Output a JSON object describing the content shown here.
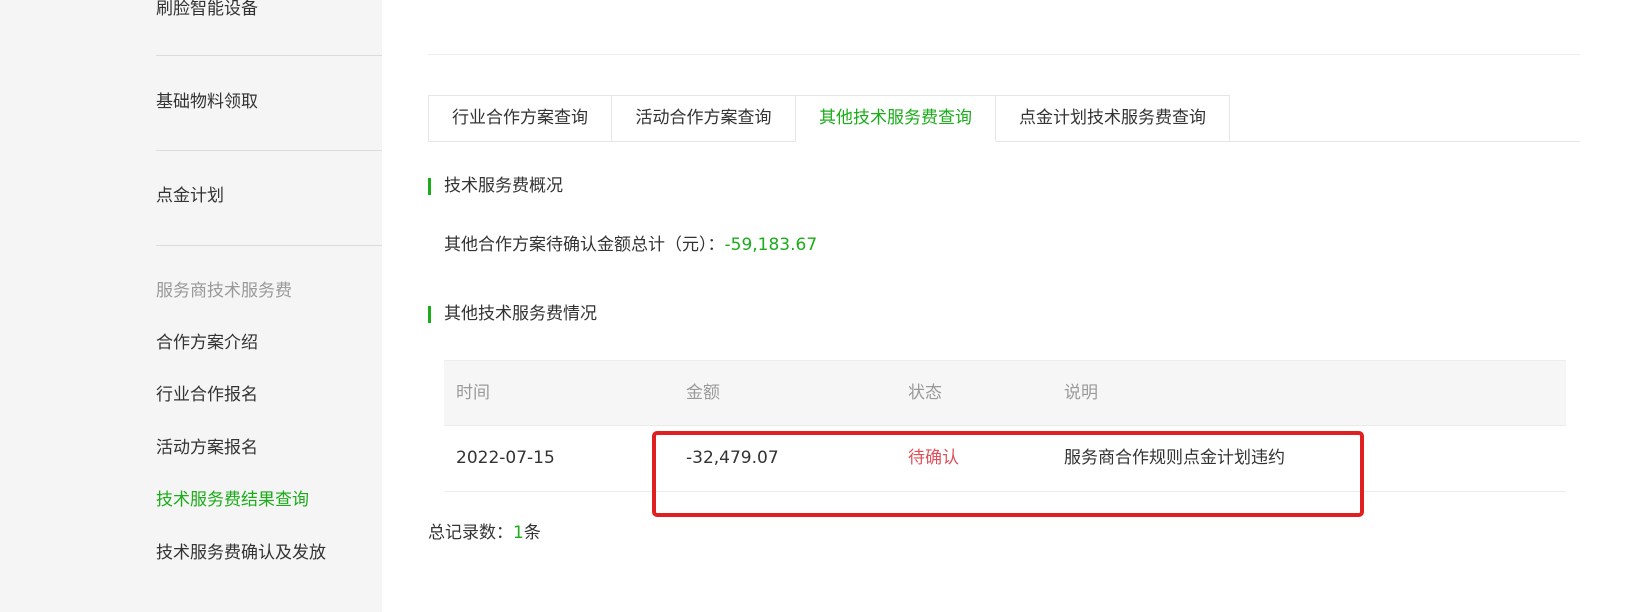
{
  "sidebar": {
    "items": [
      {
        "label": "刷脸智能设备"
      },
      {
        "label": "基础物料领取"
      },
      {
        "label": "点金计划"
      }
    ],
    "group_title": "服务商技术服务费",
    "sub_items": [
      {
        "label": "合作方案介绍"
      },
      {
        "label": "行业合作报名"
      },
      {
        "label": "活动方案报名"
      },
      {
        "label": "技术服务费结果查询"
      },
      {
        "label": "技术服务费确认及发放"
      }
    ],
    "active_item": "技术服务费结果查询"
  },
  "tabs": [
    {
      "label": "行业合作方案查询"
    },
    {
      "label": "活动合作方案查询"
    },
    {
      "label": "其他技术服务费查询"
    },
    {
      "label": "点金计划技术服务费查询"
    }
  ],
  "active_tab": "其他技术服务费查询",
  "overview": {
    "title": "技术服务费概况",
    "summary_label": "其他合作方案待确认金额总计（元）：",
    "summary_value": "-59,183.67"
  },
  "details": {
    "title": "其他技术服务费情况",
    "columns": [
      "时间",
      "金额",
      "状态",
      "说明"
    ],
    "rows": [
      {
        "time": "2022-07-15",
        "amount": "-32,479.07",
        "status": "待确认",
        "note": "服务商合作规则点金计划违约"
      }
    ],
    "total_label": "总记录数：",
    "total_count": "1",
    "total_unit": "条"
  },
  "colors": {
    "accent": "#1aad19",
    "pending": "#e0505a",
    "highlight": "#e02020"
  }
}
